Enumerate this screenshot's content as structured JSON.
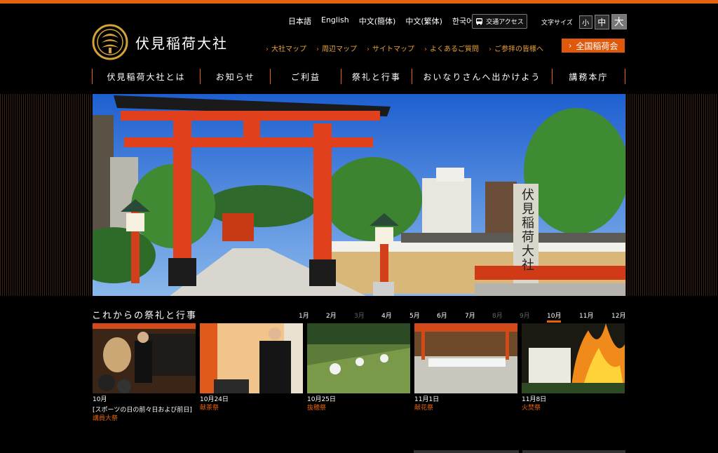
{
  "logo": {
    "text": "伏見稲荷大社"
  },
  "languages": [
    "日本語",
    "English",
    "中文(簡体)",
    "中文(繁体)",
    "한국어"
  ],
  "access": {
    "label": "交通アクセス"
  },
  "font_size": {
    "label": "文字サイズ",
    "small": "小",
    "medium": "中",
    "large": "大"
  },
  "subnav": [
    "大社マップ",
    "周辺マップ",
    "サイトマップ",
    "よくあるご質問",
    "ご参拝の皆様へ"
  ],
  "zenkoku": {
    "label": "全国稲荷会"
  },
  "mainnav": [
    "伏見稲荷大社とは",
    "お知らせ",
    "ご利益",
    "祭礼と行事",
    "おいなりさんへ出かけよう",
    "講務本庁"
  ],
  "hero": {
    "sign_text": "伏見稲荷大社"
  },
  "events": {
    "title": "これからの祭礼と行事",
    "months": [
      "1月",
      "2月",
      "3月",
      "4月",
      "5月",
      "6月",
      "7月",
      "8月",
      "9月",
      "10月",
      "11月",
      "12月"
    ],
    "dimmed_months": [
      "3月",
      "8月",
      "9月"
    ],
    "current_month": "10月",
    "items": [
      {
        "date": "10月",
        "date2": "[スポーツの日の前々日および前日]",
        "name": "講員大祭"
      },
      {
        "date": "10月24日",
        "date2": "",
        "name": "献茶祭"
      },
      {
        "date": "10月25日",
        "date2": "",
        "name": "抜穂祭"
      },
      {
        "date": "11月1日",
        "date2": "",
        "name": "献花祭"
      },
      {
        "date": "11月8日",
        "date2": "",
        "name": "火焚祭"
      }
    ]
  },
  "colors": {
    "accent": "#e8620c",
    "background": "#000000",
    "torii": "#e0401c"
  }
}
